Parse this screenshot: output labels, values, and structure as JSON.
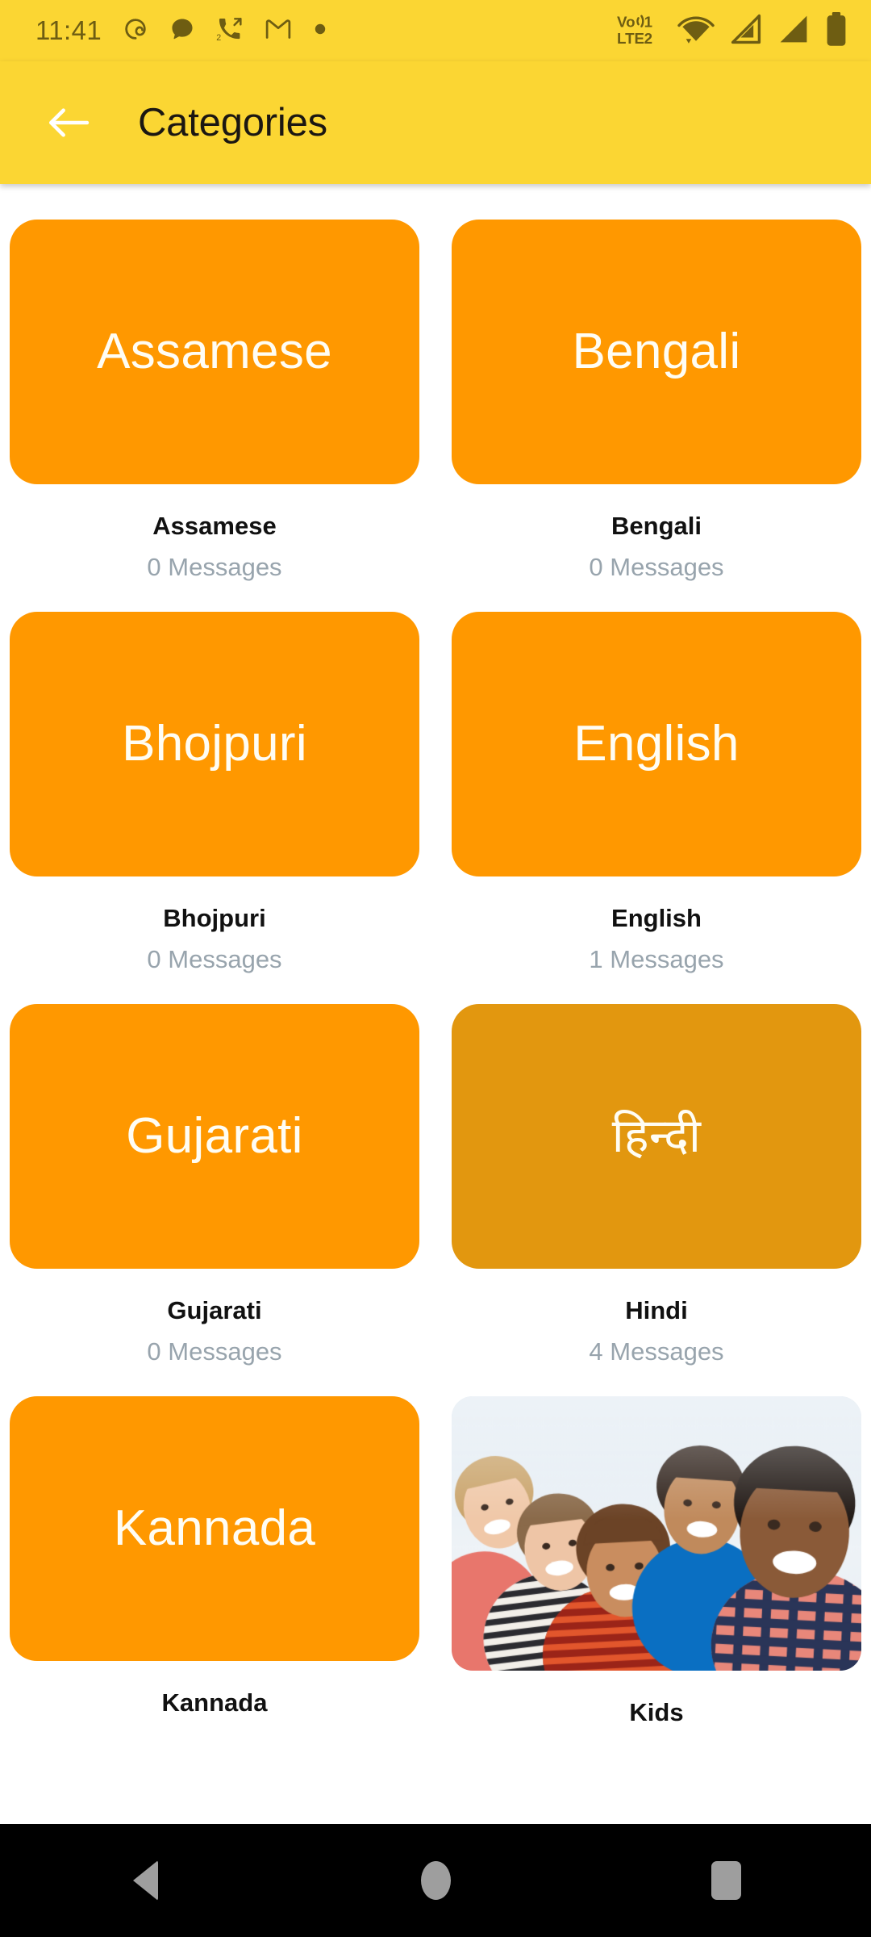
{
  "status_bar": {
    "time": "11:41",
    "left_icons": [
      {
        "name": "threads-spiral-icon"
      },
      {
        "name": "chat-bubble-icon"
      },
      {
        "name": "missed-call-icon",
        "badge": "2"
      },
      {
        "name": "gmail-icon"
      },
      {
        "name": "more-dot-icon"
      }
    ],
    "right_icons": [
      {
        "name": "volte-sim1-icon",
        "label_top": "Vo",
        "label_num": "1",
        "label_bottom": "LTE",
        "label_bottom_num": "2"
      },
      {
        "name": "wifi-icon"
      },
      {
        "name": "signal-sim1-icon"
      },
      {
        "name": "signal-sim2-icon"
      },
      {
        "name": "battery-icon"
      }
    ]
  },
  "app_bar": {
    "back_label": "Back",
    "title": "Categories"
  },
  "colors": {
    "app_bar_bg": "#FBD633",
    "tile_orange": "#FF9800",
    "tile_orange_dull": "#E2970F",
    "title_text": "#111111",
    "sub_text": "#98A4AD",
    "page_bg": "#FFFFFF",
    "nav_bar_bg": "#000000"
  },
  "categories": [
    {
      "tile_label": "Assamese",
      "title": "Assamese",
      "messages": "0 Messages",
      "tile_type": "text",
      "tile_variant": "normal"
    },
    {
      "tile_label": "Bengali",
      "title": "Bengali",
      "messages": "0 Messages",
      "tile_type": "text",
      "tile_variant": "normal"
    },
    {
      "tile_label": "Bhojpuri",
      "title": "Bhojpuri",
      "messages": "0 Messages",
      "tile_type": "text",
      "tile_variant": "normal"
    },
    {
      "tile_label": "English",
      "title": "English",
      "messages": "1 Messages",
      "tile_type": "text",
      "tile_variant": "normal"
    },
    {
      "tile_label": "Gujarati",
      "title": "Gujarati",
      "messages": "0 Messages",
      "tile_type": "text",
      "tile_variant": "normal"
    },
    {
      "tile_label": "हिन्दी",
      "title": "Hindi",
      "messages": "4 Messages",
      "tile_type": "text",
      "tile_variant": "dull"
    },
    {
      "tile_label": "Kannada",
      "title": "Kannada",
      "messages": "",
      "tile_type": "text",
      "tile_variant": "normal"
    },
    {
      "tile_label": "",
      "title": "Kids",
      "messages": "",
      "tile_type": "photo",
      "tile_variant": "photo",
      "photo_alt": "Five smiling children outdoors"
    }
  ],
  "nav_bar": {
    "back_label": "Back",
    "home_label": "Home",
    "recents_label": "Recents"
  }
}
